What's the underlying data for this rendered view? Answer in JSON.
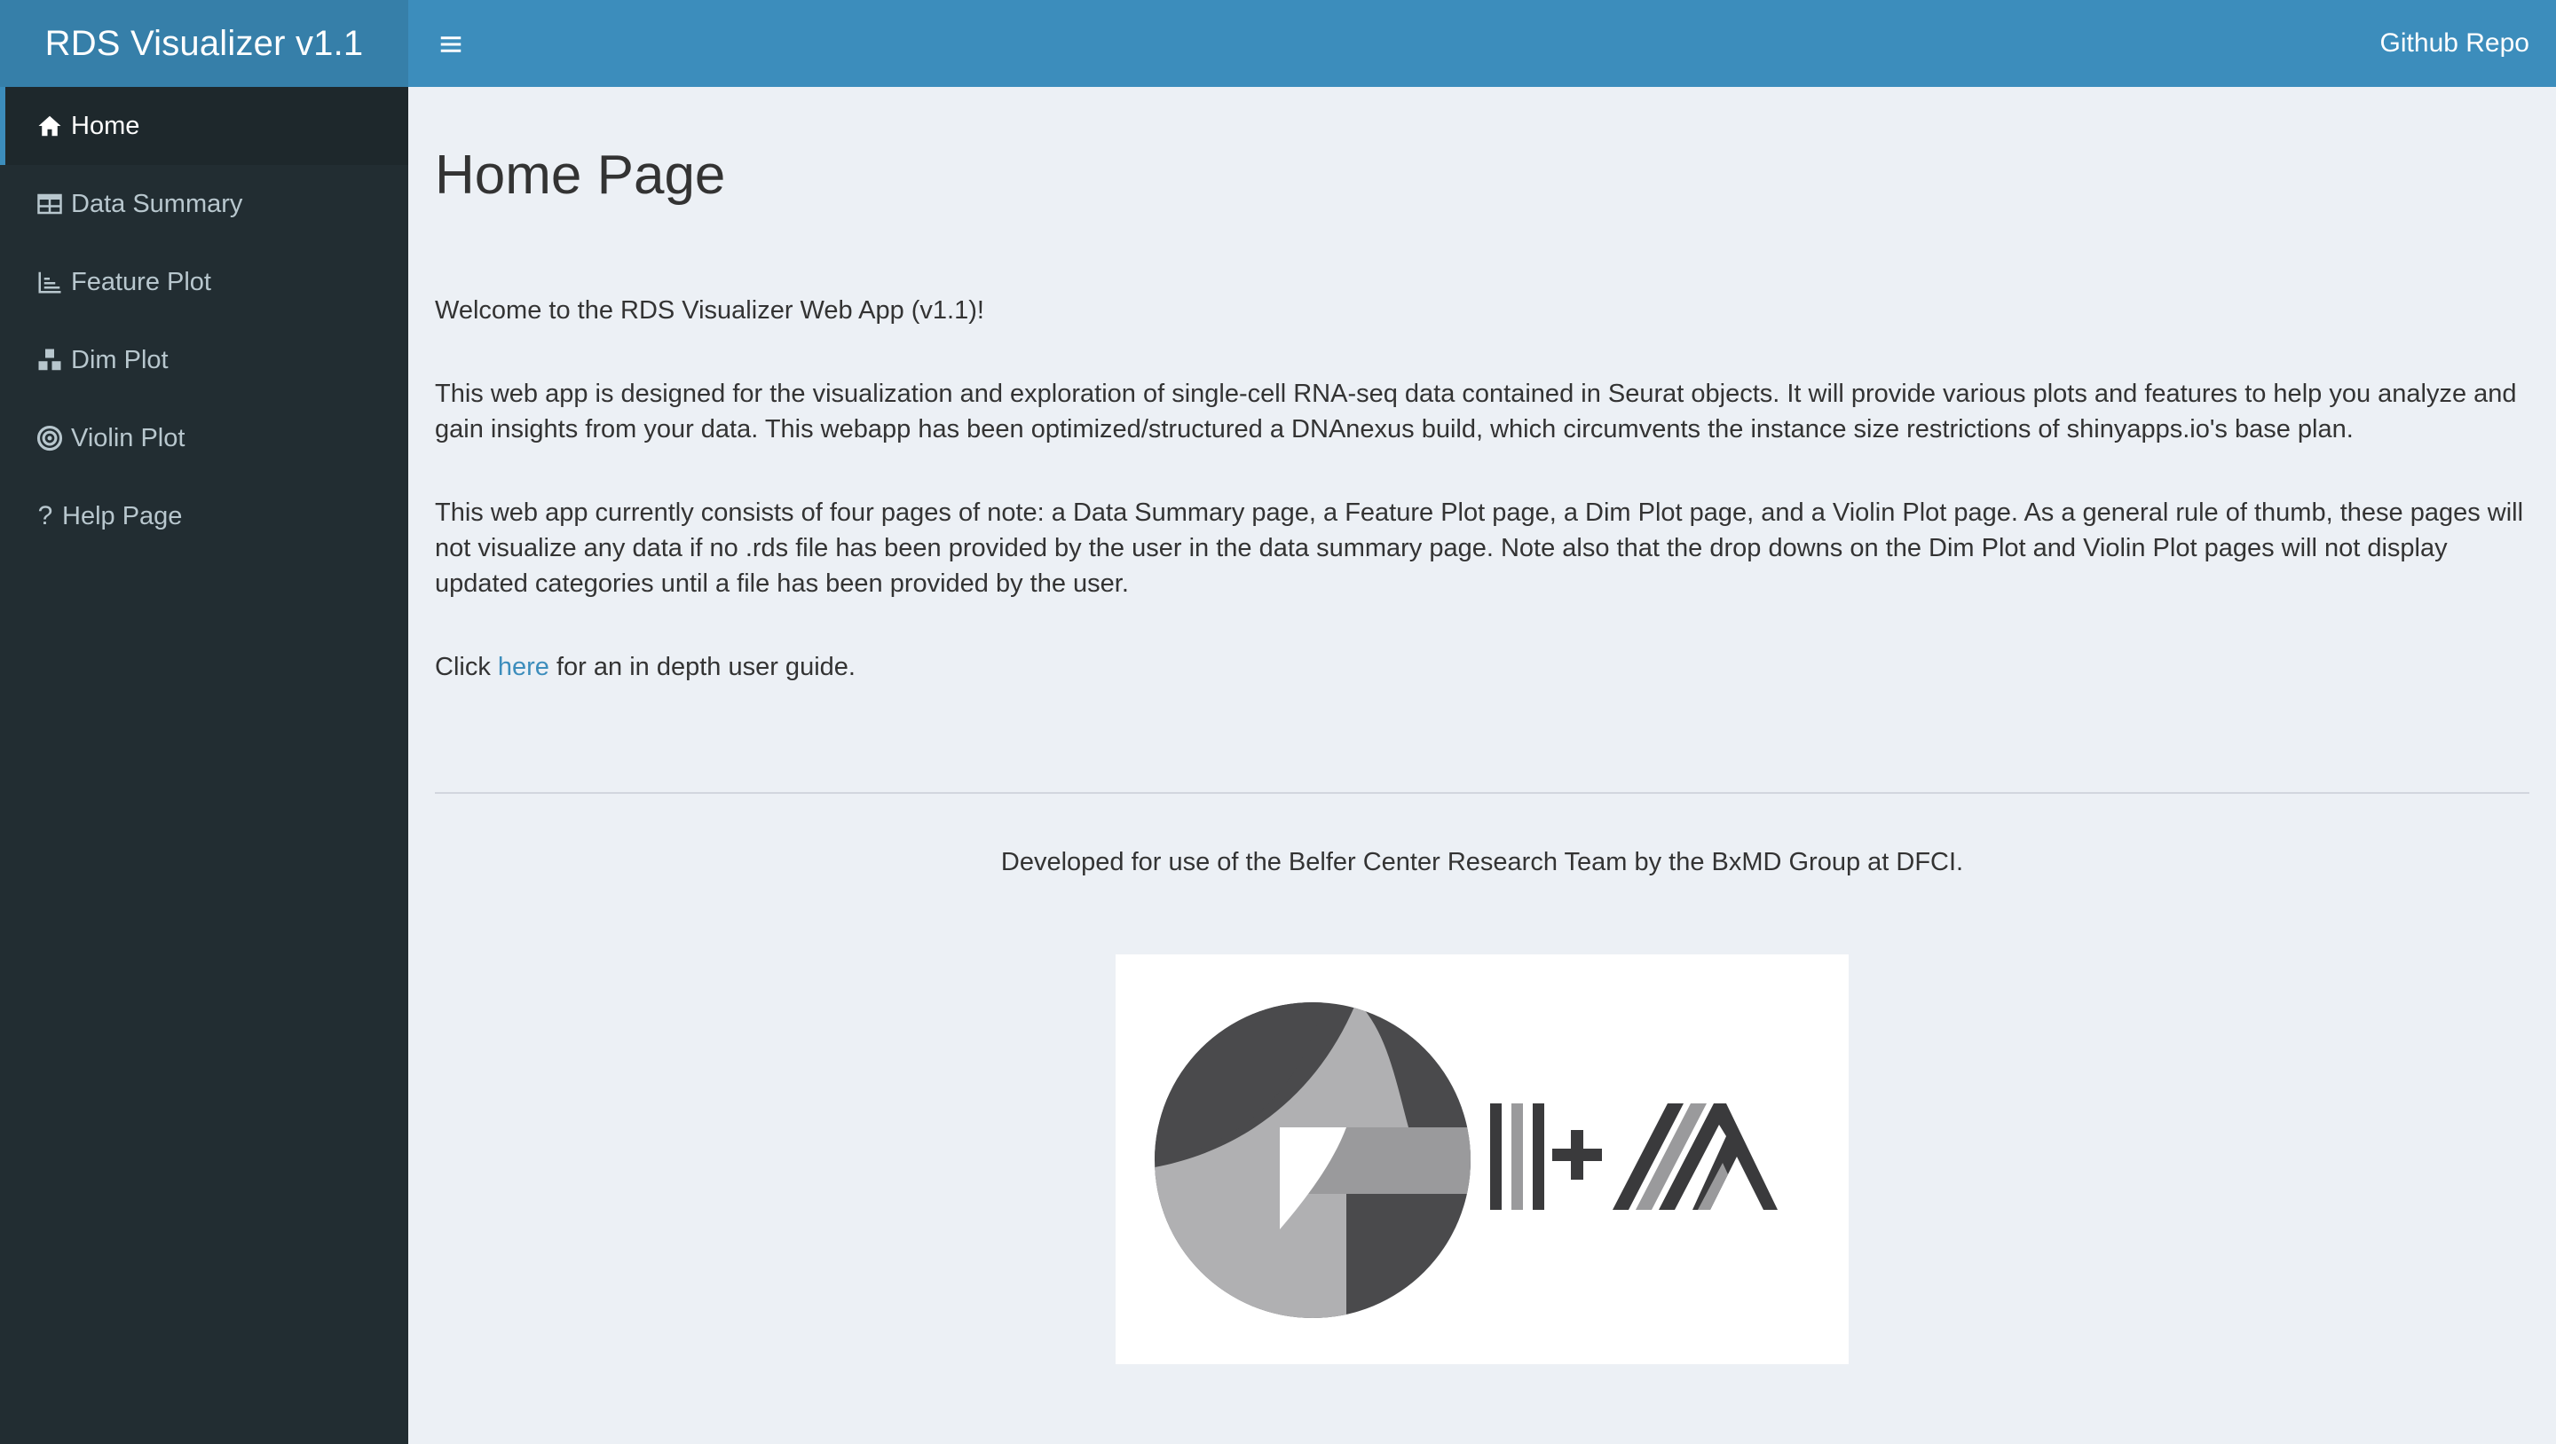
{
  "app": {
    "title": "RDS Visualizer v1.1"
  },
  "navbar": {
    "toggle_icon": "hamburger-icon",
    "github_link": "Github Repo"
  },
  "sidebar": {
    "items": [
      {
        "label": "Home",
        "icon": "home-icon",
        "active": true
      },
      {
        "label": "Data Summary",
        "icon": "table-icon",
        "active": false
      },
      {
        "label": "Feature Plot",
        "icon": "line-chart-icon",
        "active": false
      },
      {
        "label": "Dim Plot",
        "icon": "cubes-icon",
        "active": false
      },
      {
        "label": "Violin Plot",
        "icon": "bullseye-icon",
        "active": false
      },
      {
        "label": "Help Page",
        "icon": "question-icon",
        "active": false
      }
    ]
  },
  "main": {
    "title": "Home Page",
    "welcome": "Welcome to the RDS Visualizer Web App (v1.1)!",
    "intro": "This web app is designed for the visualization and exploration of single-cell RNA-seq data contained in Seurat objects. It will provide various plots and features to help you analyze and gain insights from your data. This webapp has been optimized/structured a DNAnexus build, which circumvents the instance size restrictions of shinyapps.io's base plan.",
    "pages_note": "This web app currently consists of four pages of note: a Data Summary page, a Feature Plot page, a Dim Plot page, and a Violin Plot page. As a general rule of thumb, these pages will not visualize any data if no .rds file has been provided by the user in the data summary page. Note also that the drop downs on the Dim Plot and Violin Plot pages will not display updated categories until a file has been provided by the user.",
    "guide_prefix": "Click ",
    "guide_link": "here",
    "guide_suffix": " for an in depth user guide.",
    "credit": "Developed for use of the Belfer Center Research Team by the BxMD Group at DFCI.",
    "logo": "ll+A"
  },
  "colors": {
    "header": "#3c8dbc",
    "header_logo": "#367fa9",
    "sidebar": "#222d32",
    "sidebar_active": "#1e282c",
    "content_bg": "#ecf0f5",
    "link": "#3c8dbc"
  }
}
